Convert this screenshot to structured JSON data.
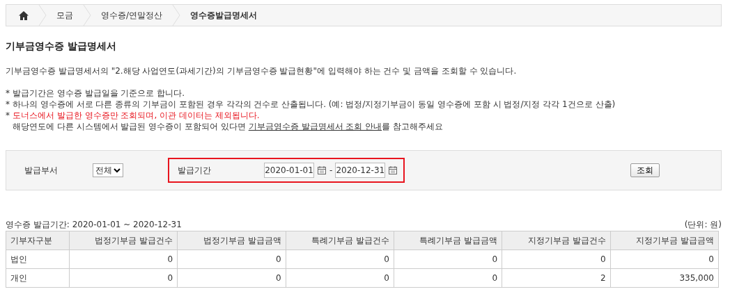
{
  "breadcrumb": [
    {
      "label": "모금",
      "selected": false
    },
    {
      "label": "영수증/연말정산",
      "selected": false
    },
    {
      "label": "영수증발급명세서",
      "selected": true
    }
  ],
  "title": "기부금영수증 발급명세서",
  "description": "기부금영수증 발급명세서의 \"2.해당 사업연도(과세기간)의 기부금영수증 발급현황\"에 입력해야 하는 건수 및 금액을 조회할 수 있습니다.",
  "notes": [
    {
      "marker": "*",
      "text": "발급기간은 영수증 발급일을 기준으로 합니다.",
      "highlight": false
    },
    {
      "marker": "*",
      "text": "하나의 영수증에 서로 다른 종류의 기부금이 포함된 경우 각각의 건수로 산출됩니다. (예: 법정/지정기부금이 동일 영수증에 포함 시 법정/지정 각각 1건으로 산출)",
      "highlight": false
    },
    {
      "marker": "*",
      "text": "도너스에서 발급한 영수증만 조회되며, 이관 데이터는 제외됩니다.",
      "highlight": true
    }
  ],
  "guide": {
    "text": "해당연도에 다른 시스템에서 발급된 영수증이 포함되어 있다면 ",
    "link": "기부금영수증 발급명세서 조회 안내",
    "suffix": "를 참고해주세요"
  },
  "filter": {
    "department_label": "발급부서",
    "department_value": "전체",
    "period_label": "발급기간",
    "period_highlighted": true,
    "start_date": "2020-01-01",
    "separator": "-",
    "end_date": "2020-12-31",
    "search_button": "조회"
  },
  "table": {
    "caption": "영수증 발급기간: 2020-01-01 ~ 2020-12-31",
    "unit": "(단위: 원)",
    "columns": [
      "기부자구분",
      "법정기부금 발급건수",
      "법정기부금 발급금액",
      "특례기부금 발급건수",
      "특례기부금 발급금액",
      "지정기부금 발급건수",
      "지정기부금 발급금액"
    ],
    "rows": [
      [
        "법인",
        "0",
        "0",
        "0",
        "0",
        "0",
        "0"
      ],
      [
        "개인",
        "0",
        "0",
        "0",
        "0",
        "2",
        "335,000"
      ]
    ]
  }
}
